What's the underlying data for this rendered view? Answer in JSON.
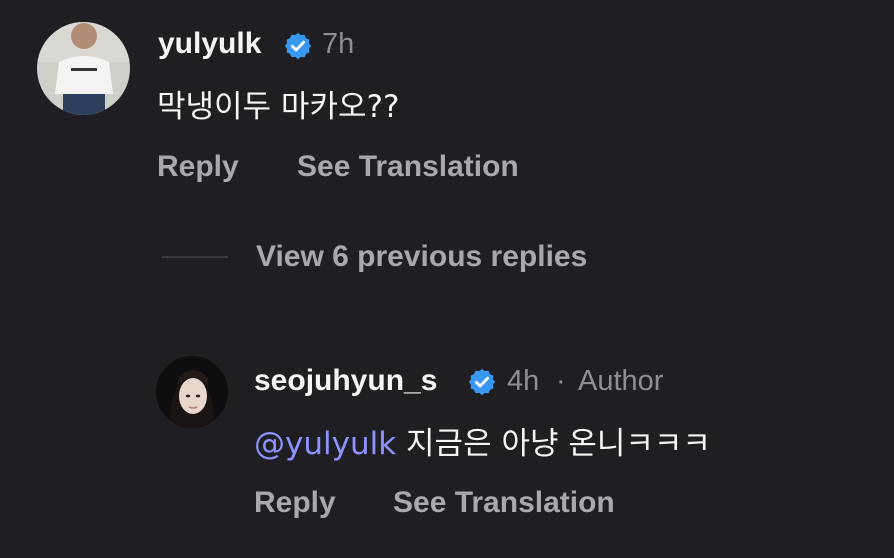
{
  "comment": {
    "username": "yulyulk",
    "time": "7h",
    "text": "막냉이두 마카오??",
    "reply_label": "Reply",
    "translate_label": "See Translation"
  },
  "view_replies": {
    "label": "View 6 previous replies"
  },
  "reply": {
    "username": "seojuhyun_s",
    "time": "4h",
    "separator": "·",
    "author_label": "Author",
    "mention": "@yulyulk",
    "text": "지금은 아냥 온니ㅋㅋㅋ",
    "reply_label": "Reply",
    "translate_label": "See Translation"
  },
  "colors": {
    "background": "#1f1f23",
    "verified": "#3897f0",
    "mention": "#8c93ff",
    "muted": "#8e8e93"
  }
}
